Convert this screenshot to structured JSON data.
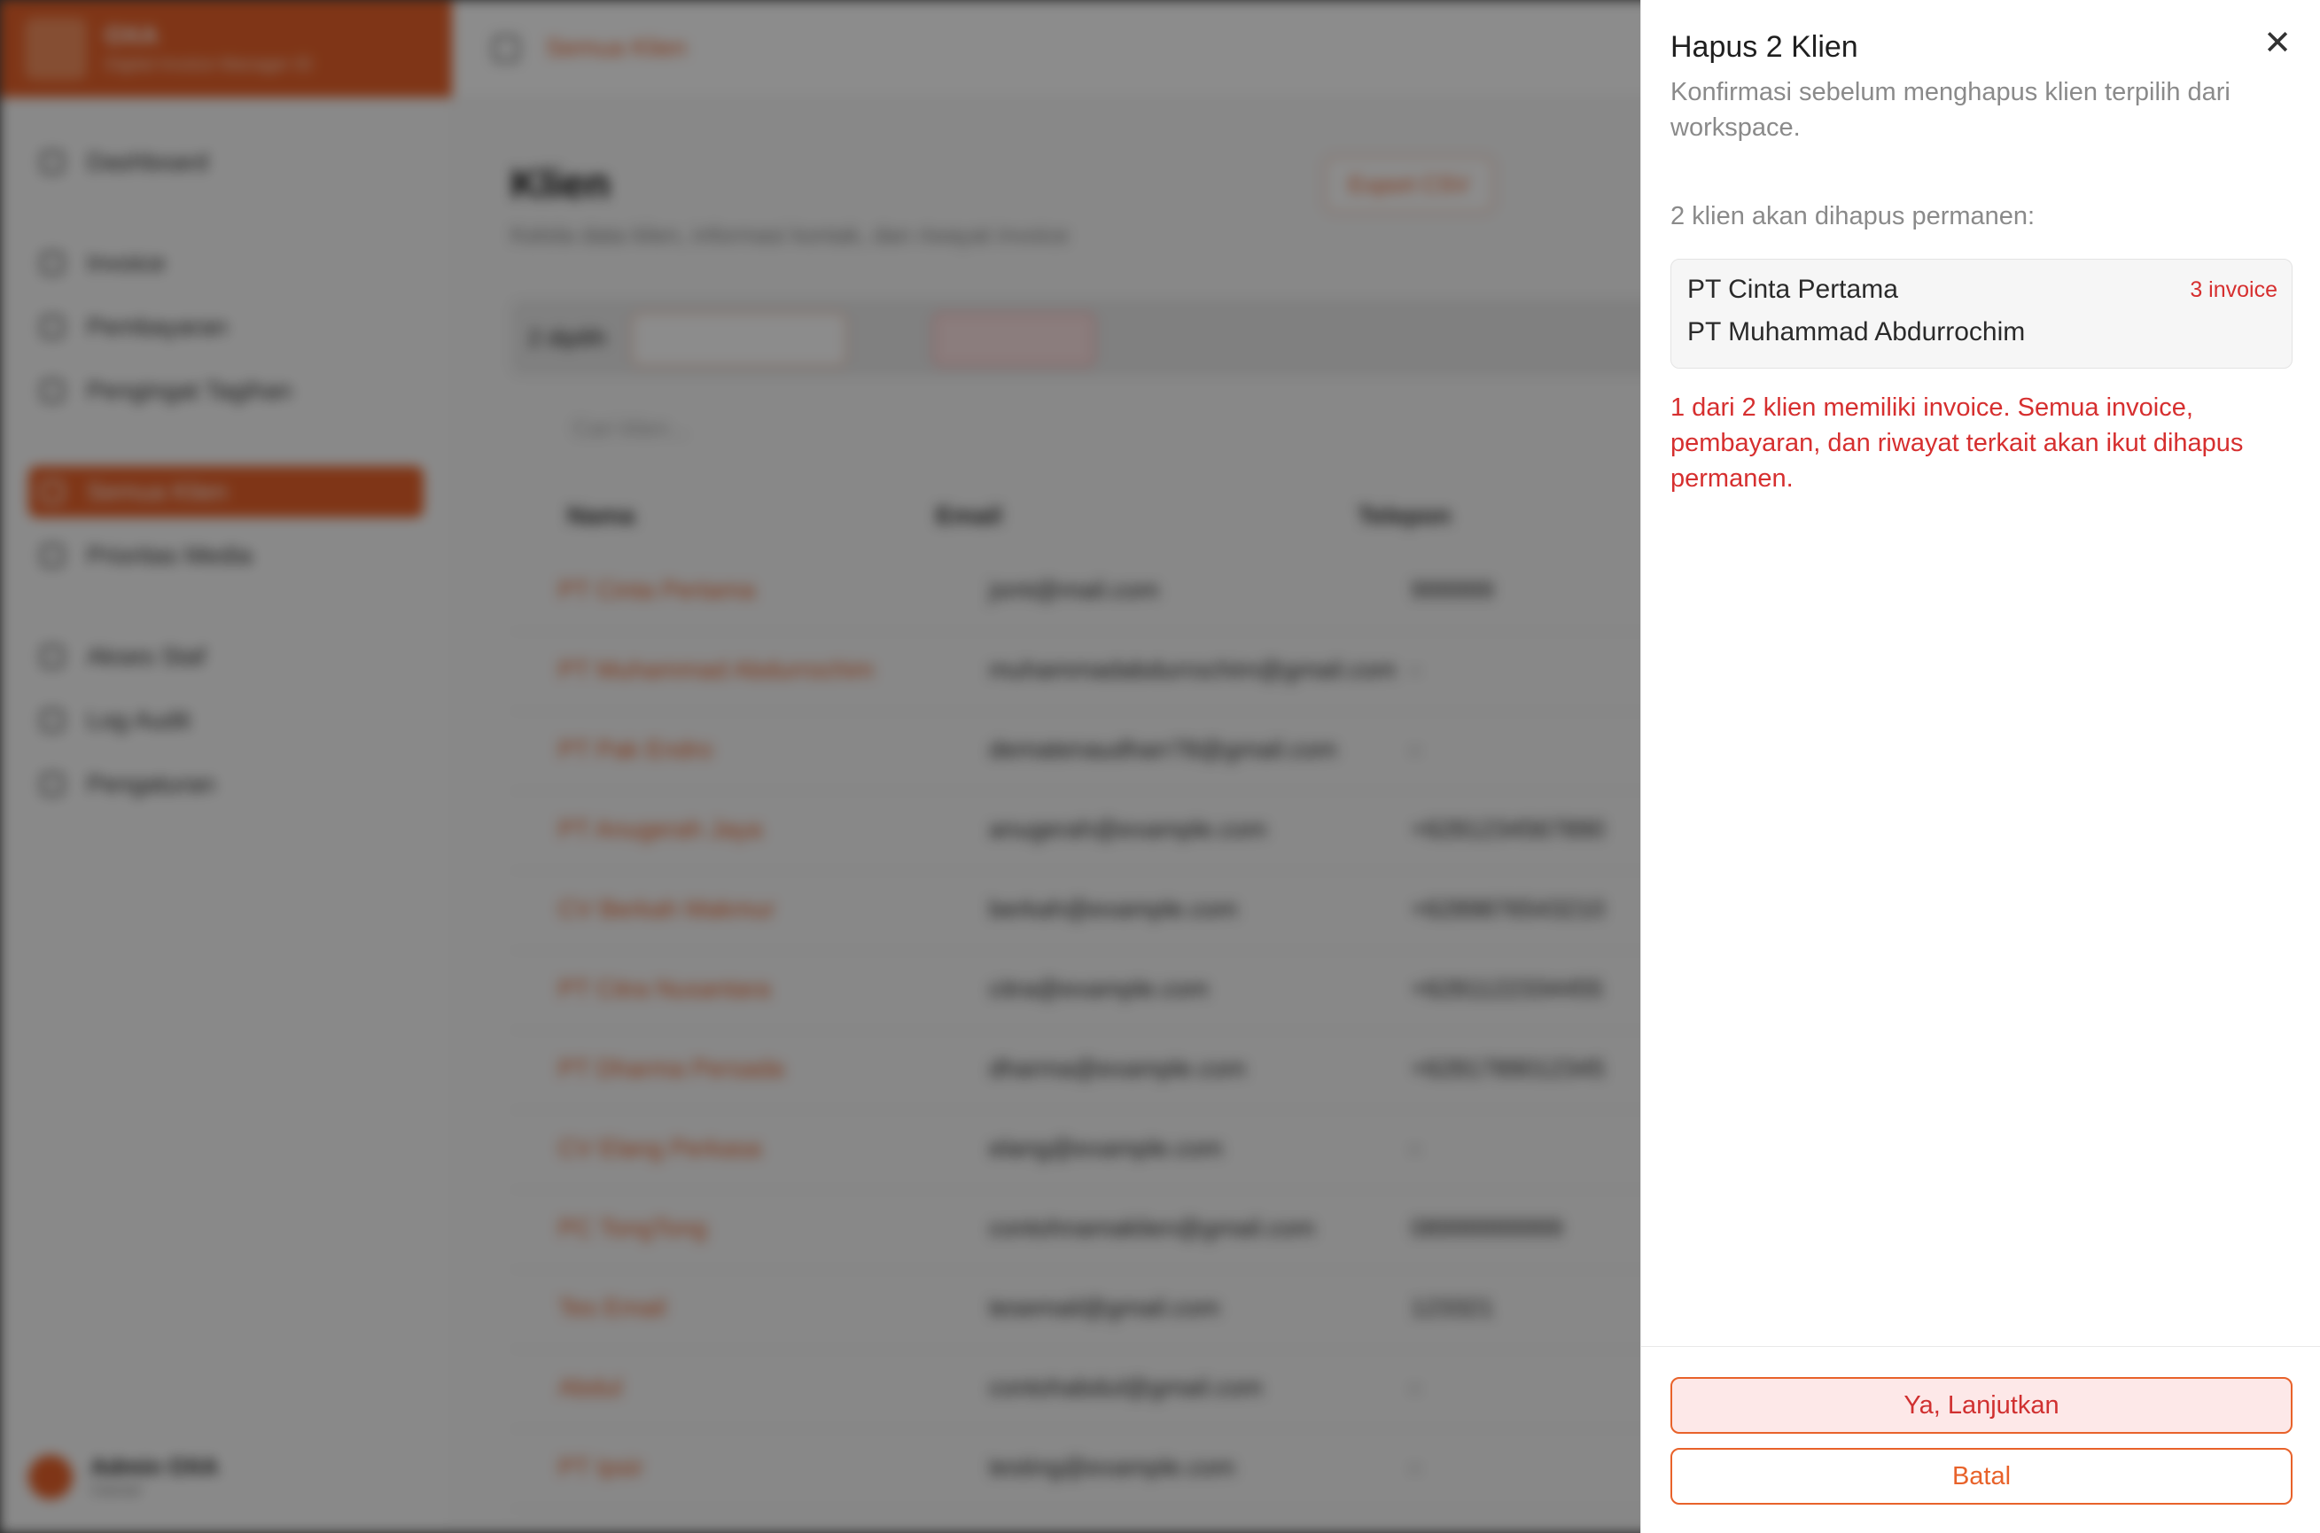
{
  "colors": {
    "accent": "#e8622a",
    "danger": "#d62f2f",
    "danger_bg": "#fde8e8"
  },
  "background": {
    "brand": {
      "name": "OXA",
      "tagline": "Digital Invoice Manager ID"
    },
    "sidebar": {
      "items": [
        {
          "label": "Dashboard",
          "icon": "dashboard-icon"
        },
        {
          "label": "Invoice",
          "icon": "invoice-icon"
        },
        {
          "label": "Pembayaran",
          "icon": "payment-icon"
        },
        {
          "label": "Pengingat Tagihan",
          "icon": "reminder-icon"
        },
        {
          "label": "Semua Klien",
          "icon": "clients-icon"
        },
        {
          "label": "Prioritas Media",
          "icon": "priority-icon"
        },
        {
          "label": "Akses Staf",
          "icon": "staff-icon"
        },
        {
          "label": "Log Audit",
          "icon": "audit-icon"
        },
        {
          "label": "Pengaturan",
          "icon": "settings-icon"
        }
      ],
      "user": {
        "name": "Admin OXA",
        "role": "Owner"
      }
    },
    "topbar": {
      "breadcrumb": "Semua Klien"
    },
    "page": {
      "title": "Klien",
      "subtitle": "Kelola data klien, informasi kontak, dan riwayat invoice",
      "export_button": "Export CSV",
      "bulk": {
        "selected": "2 dipilih",
        "export": "Export CSV",
        "delete": "Hapus"
      },
      "search_placeholder": "Cari klien..."
    },
    "table": {
      "headers": [
        "Nama",
        "Email",
        "Telepon"
      ],
      "rows": [
        [
          "PT Cinta Pertama",
          "jsmt@mail.com",
          "999999"
        ],
        [
          "PT Muhammad Abdurrochim",
          "muhammadabdurrochim@gmail.com",
          "-"
        ],
        [
          "PT Pak Endro",
          "dematenaudharr78@gmail.com",
          "-"
        ],
        [
          "PT Anugerah Jaya",
          "anugerah@example.com",
          "+6281234567890"
        ],
        [
          "CV Berkah Makmur",
          "berkah@example.com",
          "+6289876543210"
        ],
        [
          "PT Citra Nusantara",
          "citra@example.com",
          "+6281122334455"
        ],
        [
          "PT Dharma Persada",
          "dharma@example.com",
          "+6281789012345"
        ],
        [
          "CV Elang Perkasa",
          "elang@example.com",
          "-"
        ],
        [
          "PC TongTong",
          "contohnamaklien@gmail.com",
          "08999999999"
        ],
        [
          "Tes Email",
          "tesemail@gmail.com",
          "123321"
        ],
        [
          "Abdul",
          "contohabdul@gmail.com",
          "-"
        ],
        [
          "PT Ipsir",
          "testing@example.com",
          "-"
        ]
      ]
    }
  },
  "drawer": {
    "title": "Hapus 2 Klien",
    "description": "Konfirmasi sebelum menghapus klien terpilih dari workspace.",
    "count_text": "2 klien akan dihapus permanen:",
    "clients": [
      {
        "name": "PT Cinta Pertama",
        "badge": "3 invoice"
      },
      {
        "name": "PT Muhammad Abdurrochim",
        "badge": ""
      }
    ],
    "warning": "1 dari 2 klien memiliki invoice. Semua invoice, pembayaran, dan riwayat terkait akan ikut dihapus permanen.",
    "confirm_label": "Ya, Lanjutkan",
    "cancel_label": "Batal",
    "close_icon": "close-icon"
  }
}
